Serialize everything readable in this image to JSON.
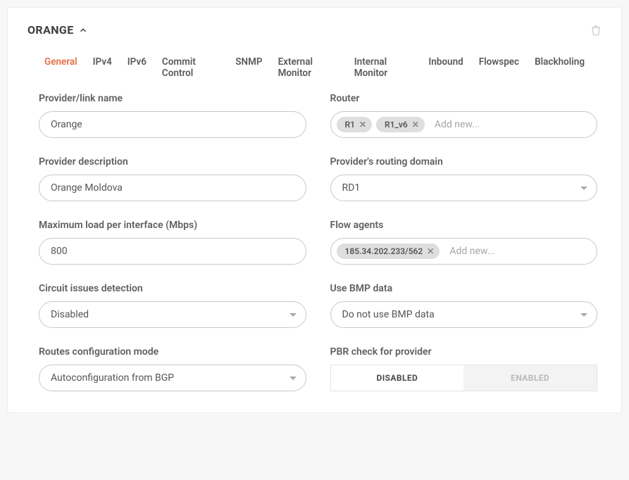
{
  "header": {
    "title": "ORANGE"
  },
  "tabs": [
    {
      "label": "General",
      "active": true
    },
    {
      "label": "IPv4",
      "active": false
    },
    {
      "label": "IPv6",
      "active": false
    },
    {
      "label": "Commit Control",
      "active": false
    },
    {
      "label": "SNMP",
      "active": false
    },
    {
      "label": "External Monitor",
      "active": false
    },
    {
      "label": "Internal Monitor",
      "active": false
    },
    {
      "label": "Inbound",
      "active": false
    },
    {
      "label": "Flowspec",
      "active": false
    },
    {
      "label": "Blackholing",
      "active": false
    }
  ],
  "fields": {
    "provider_name": {
      "label": "Provider/link name",
      "value": "Orange"
    },
    "router": {
      "label": "Router",
      "tags": [
        "R1",
        "R1_v6"
      ],
      "placeholder": "Add new..."
    },
    "provider_description": {
      "label": "Provider description",
      "value": "Orange Moldova"
    },
    "routing_domain": {
      "label": "Provider's routing domain",
      "value": "RD1"
    },
    "max_load": {
      "label": "Maximum load per interface (Mbps)",
      "value": "800"
    },
    "flow_agents": {
      "label": "Flow agents",
      "tags": [
        "185.34.202.233/562"
      ],
      "placeholder": "Add new..."
    },
    "circuit_issues": {
      "label": "Circuit issues detection",
      "value": "Disabled"
    },
    "use_bmp": {
      "label": "Use BMP data",
      "value": "Do not use BMP data"
    },
    "routes_mode": {
      "label": "Routes configuration mode",
      "value": "Autoconfiguration from BGP"
    },
    "pbr_check": {
      "label": "PBR check for provider",
      "options": [
        "DISABLED",
        "ENABLED"
      ],
      "selected": "DISABLED"
    }
  }
}
